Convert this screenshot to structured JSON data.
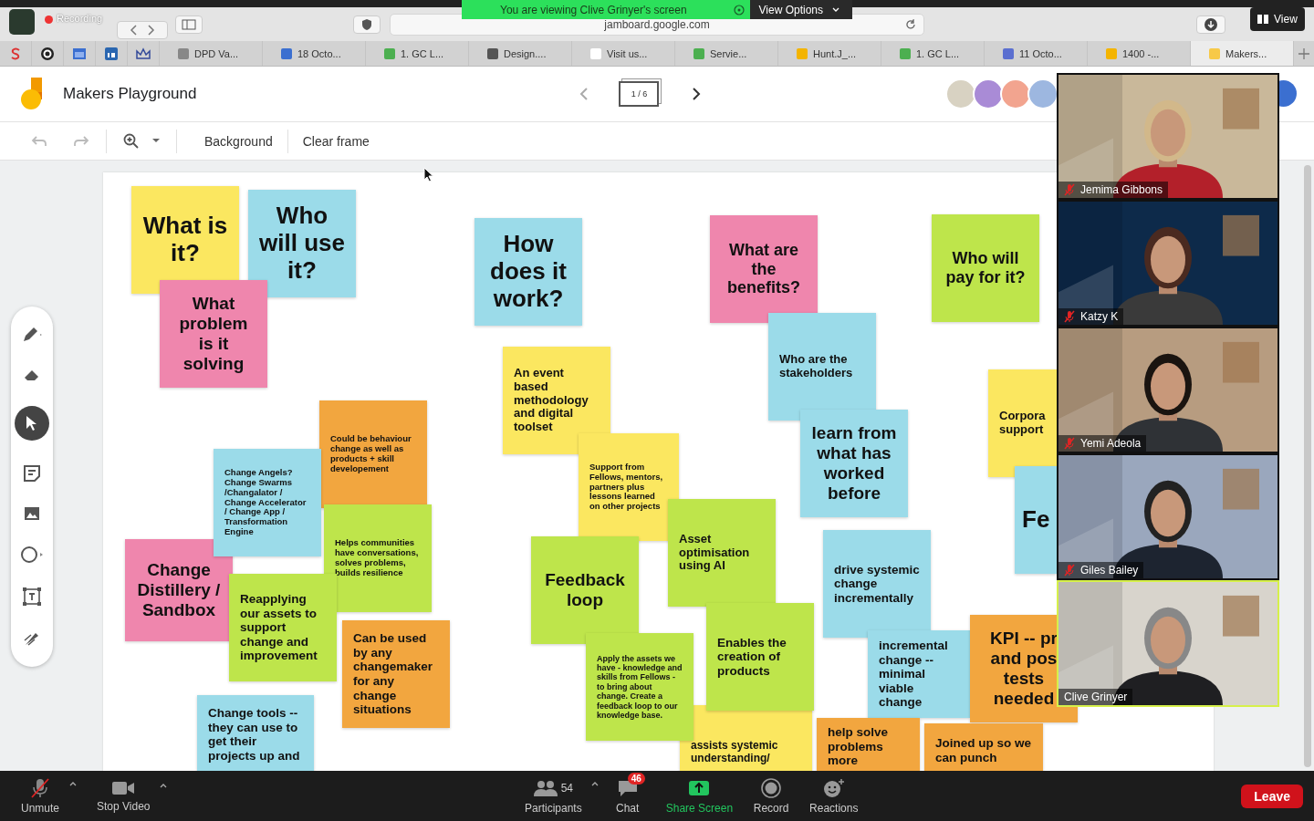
{
  "browser": {
    "recording_label": "Recording",
    "address": "jamboard.google.com",
    "tabs": [
      {
        "label": "DPD Va...",
        "selected": false
      },
      {
        "label": "18 Octo...",
        "selected": false
      },
      {
        "label": "1. GC L...",
        "selected": false
      },
      {
        "label": "Design....",
        "selected": false
      },
      {
        "label": "Visit us...",
        "selected": false
      },
      {
        "label": "Servie...",
        "selected": false
      },
      {
        "label": "Hunt.J_...",
        "selected": false
      },
      {
        "label": "1. GC L...",
        "selected": false
      },
      {
        "label": "11 Octo...",
        "selected": false
      },
      {
        "label": "1400 -...",
        "selected": false
      },
      {
        "label": "Makers...",
        "selected": true
      }
    ]
  },
  "share_banner": {
    "text": "You are viewing Clive Grinyer's screen",
    "options": "View Options"
  },
  "view_button": "View",
  "jamboard": {
    "title": "Makers Playground",
    "frame_indicator": "1 / 6",
    "toolbar": [
      "Background",
      "Clear frame"
    ],
    "notes": [
      {
        "text": "What is it?",
        "color": "#fbe760"
      },
      {
        "text": "Who will use it?",
        "color": "#9bdbe9"
      },
      {
        "text": "How does it work?",
        "color": "#9bdbe9"
      },
      {
        "text": "What are the benefits?",
        "color": "#ef86ad"
      },
      {
        "text": "Who will pay for it?",
        "color": "#bee54b"
      },
      {
        "text": "What problem is it solving",
        "color": "#ef86ad"
      },
      {
        "text": "Who are the stakeholders",
        "color": "#9bdbe9"
      },
      {
        "text": "An event based methodology and digital toolset",
        "color": "#fbe760"
      },
      {
        "text": "Corpora\nsupport",
        "color": "#fbe760"
      },
      {
        "text": "Could be behaviour change as well as products + skill developement",
        "color": "#f2a63f"
      },
      {
        "text": "learn from what has worked before",
        "color": "#9bdbe9"
      },
      {
        "text": "Change Angels? Change Swarms /Changalator / Change Accelerator / Change App / Transformation Engine",
        "color": "#9bdbe9"
      },
      {
        "text": "Support from Fellows, mentors, partners plus lessons learned on other projects",
        "color": "#fbe760"
      },
      {
        "text": "Fe",
        "color": "#9bdbe9"
      },
      {
        "text": "Helps communities have conversations, solves problems, builds resilience",
        "color": "#bee54b"
      },
      {
        "text": "Asset optimisation using AI",
        "color": "#bee54b"
      },
      {
        "text": "Change Distillery / Sandbox",
        "color": "#ef86ad"
      },
      {
        "text": "Feedback loop",
        "color": "#bee54b"
      },
      {
        "text": "drive systemic change incrementally",
        "color": "#9bdbe9"
      },
      {
        "text": "Reapplying our assets to support change and improvement",
        "color": "#bee54b"
      },
      {
        "text": "Can be used by any changemaker for any change situations",
        "color": "#f2a63f"
      },
      {
        "text": "Enables the creation of products",
        "color": "#bee54b"
      },
      {
        "text": "KPI -- pr\nand pos\ntests\nneeded",
        "color": "#f2a63f"
      },
      {
        "text": "Apply the assets we have - knowledge and skills from Fellows - to bring about change. Create a feedback loop to our knowledge base.",
        "color": "#bee54b"
      },
      {
        "text": "incremental change -- minimal viable change",
        "color": "#9bdbe9"
      },
      {
        "text": "Change tools -- they can use to get their projects up and",
        "color": "#9bdbe9"
      },
      {
        "text": "assists systemic understanding/",
        "color": "#fbe760"
      },
      {
        "text": "help solve problems more",
        "color": "#f2a63f"
      },
      {
        "text": "Joined up so we can punch",
        "color": "#f2a63f"
      }
    ]
  },
  "participants_video": [
    {
      "name": "Jemima Gibbons",
      "muted": true,
      "active": false
    },
    {
      "name": "Katzy K",
      "muted": true,
      "active": false
    },
    {
      "name": "Yemi Adeola",
      "muted": true,
      "active": false
    },
    {
      "name": "Giles Bailey",
      "muted": true,
      "active": false
    },
    {
      "name": "Clive Grinyer",
      "muted": false,
      "active": true
    }
  ],
  "meeting_controls": [
    {
      "kind": "mic",
      "label": "Unmute"
    },
    {
      "kind": "video",
      "label": "Stop Video"
    },
    {
      "kind": "participants",
      "label": "Participants",
      "count": "54"
    },
    {
      "kind": "chat",
      "label": "Chat",
      "badge": "46"
    },
    {
      "kind": "share",
      "label": "Share Screen"
    },
    {
      "kind": "record",
      "label": "Record"
    },
    {
      "kind": "reactions",
      "label": "Reactions"
    }
  ],
  "leave": "Leave"
}
